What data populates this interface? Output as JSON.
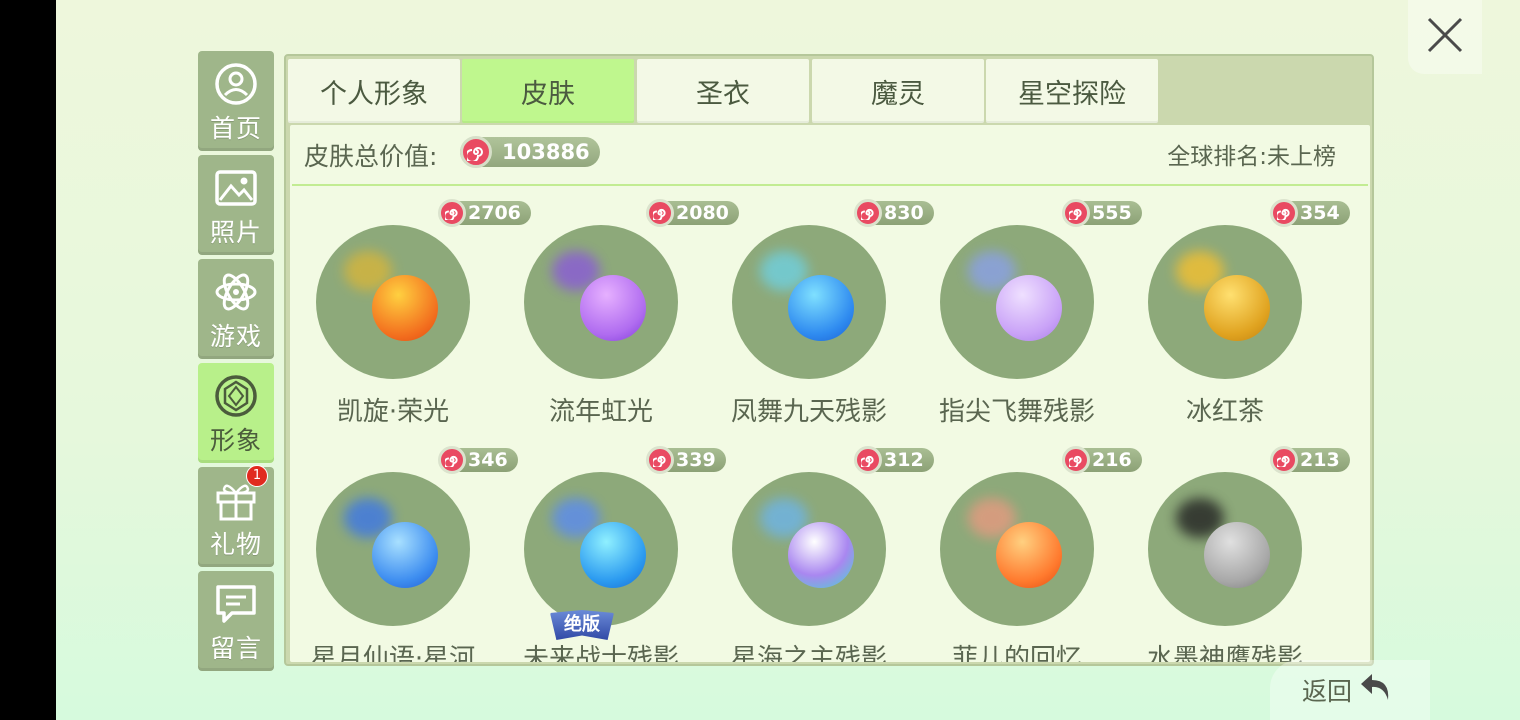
{
  "close": {
    "icon": "close-icon"
  },
  "sidebar": {
    "items": [
      {
        "label": "首页",
        "icon": "user-circle-icon"
      },
      {
        "label": "照片",
        "icon": "photo-icon"
      },
      {
        "label": "游戏",
        "icon": "atom-icon"
      },
      {
        "label": "形象",
        "icon": "skin-icon",
        "active": true
      },
      {
        "label": "礼物",
        "icon": "gift-icon",
        "badge": "1"
      },
      {
        "label": "留言",
        "icon": "message-icon"
      }
    ]
  },
  "tabs": [
    "个人形象",
    "皮肤",
    "圣衣",
    "魔灵",
    "星空探险"
  ],
  "active_tab": "皮肤",
  "summary": {
    "label": "皮肤总价值:",
    "value": "103886",
    "rank_label": "全球排名:未上榜"
  },
  "items": [
    {
      "name": "凯旋·荣光",
      "price": "2706",
      "ball": "#f26b1d",
      "trail": "#d6b53b"
    },
    {
      "name": "流年虹光",
      "price": "2080",
      "ball": "#b06cf0",
      "trail": "#8a5ad8"
    },
    {
      "name": "凤舞九天残影",
      "price": "830",
      "ball": "#2f8bf0",
      "trail": "#6fd0e0"
    },
    {
      "name": "指尖飞舞残影",
      "price": "555",
      "ball": "#c9a2f7",
      "trail": "#8aa0e8"
    },
    {
      "name": "冰红茶",
      "price": "354",
      "ball": "#e0a320",
      "trail": "#f4c030"
    },
    {
      "name": "星月仙语·星河",
      "price": "346",
      "ball": "#3d8df0",
      "trail": "#3d77e6"
    },
    {
      "name": "未来战士残影",
      "price": "339",
      "ball": "#2b9af0",
      "trail": "#5a8bf0",
      "badge": "绝版"
    },
    {
      "name": "星海之主残影",
      "price": "312",
      "ball": "#a987f0",
      "trail": "#6db4e8"
    },
    {
      "name": "菲儿的回忆",
      "price": "216",
      "ball": "#ff7a2e",
      "trail": "#e69a80"
    },
    {
      "name": "水墨神鹰残影",
      "price": "213",
      "ball": "#a8a8a8",
      "trail": "#222222"
    }
  ],
  "back": {
    "label": "返回",
    "icon": "return-arrow-icon"
  }
}
